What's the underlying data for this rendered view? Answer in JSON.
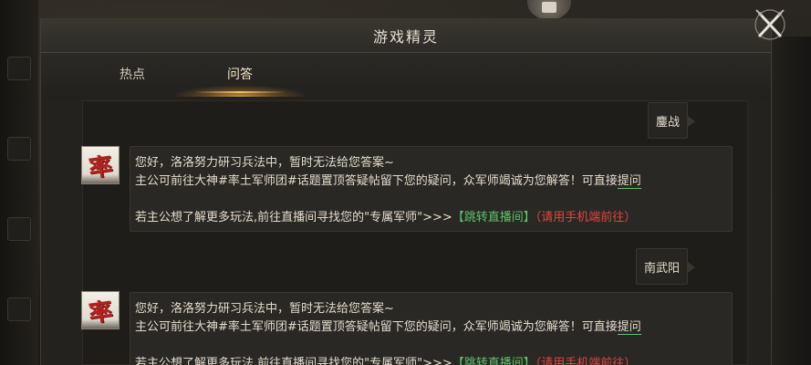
{
  "window": {
    "title": "游戏精灵"
  },
  "tabs": [
    {
      "label": "热点",
      "active": false
    },
    {
      "label": "问答",
      "active": true
    }
  ],
  "colors": {
    "link_green": "#5ec36b",
    "link_red": "#e0463f",
    "tab_glow": "#f0c46a"
  },
  "messages": [
    {
      "user": "鏖战",
      "reply": {
        "avatar_glyph": "率",
        "line1": "您好，洛洛努力研习兵法中，暂时无法给您答案~",
        "line2_pre": "主公可前往大神#率土军师团#话题置顶答疑帖留下您的疑问，众军师竭诚为您解答！可直接",
        "line2_link": "提问",
        "line3_pre": "若主公想了解更多玩法,前往直播间寻找您的\"专属军师\">>>",
        "line3_link": "【跳转直播间】",
        "line3_note": "（请用手机端前往）"
      }
    },
    {
      "user": "南武阳",
      "reply": {
        "avatar_glyph": "率",
        "line1": "您好，洛洛努力研习兵法中，暂时无法给您答案~",
        "line2_pre": "主公可前往大神#率土军师团#话题置顶答疑帖留下您的疑问，众军师竭诚为您解答！可直接",
        "line2_link": "提问",
        "line3_pre": "若主公想了解更多玩法,前往直播间寻找您的\"专属军师\">>>",
        "line3_link": "【跳转直播间】",
        "line3_note": "（请用手机端前往）"
      }
    }
  ]
}
